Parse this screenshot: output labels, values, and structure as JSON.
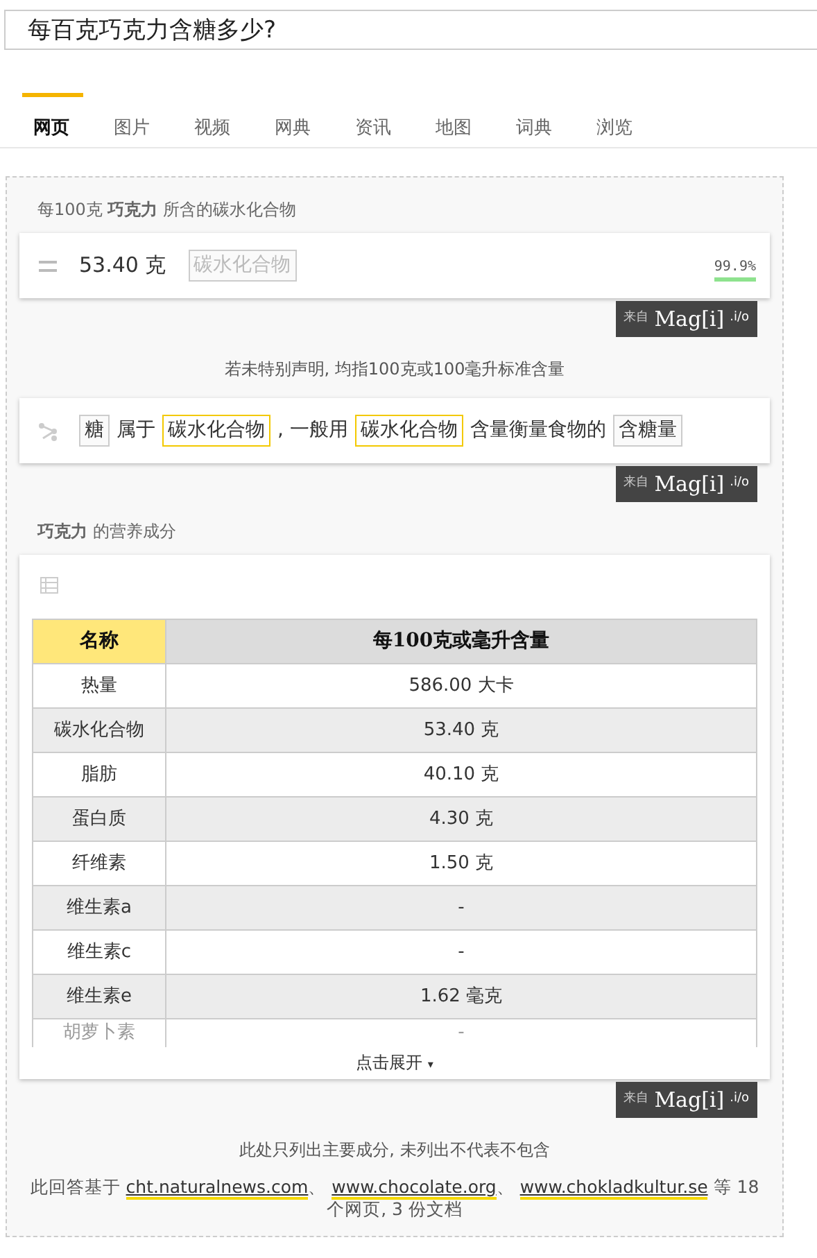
{
  "search": {
    "value": "每百克巧克力含糖多少?"
  },
  "tabs": [
    {
      "label": "网页",
      "selected": true
    },
    {
      "label": "图片",
      "selected": false
    },
    {
      "label": "视频",
      "selected": false
    },
    {
      "label": "网典",
      "selected": false
    },
    {
      "label": "资讯",
      "selected": false
    },
    {
      "label": "地图",
      "selected": false
    },
    {
      "label": "词典",
      "selected": false
    },
    {
      "label": "浏览",
      "selected": false
    }
  ],
  "answer": {
    "title": "每100克 **巧克力** 所含的碳水化合物",
    "value": "53.40 克",
    "tag": "碳水化合物",
    "confidence": "99.9%"
  },
  "source_badges": [
    {
      "prefix": "来自",
      "brand": "Mag[i]",
      "suffix": ".i/o"
    },
    {
      "prefix": "来自",
      "brand": "Mag[i]",
      "suffix": ".i/o"
    },
    {
      "prefix": "来自",
      "brand": "Mag[i]",
      "suffix": ".i/o"
    }
  ],
  "note": "若未特别声明, 均指100克或100毫升标准含量",
  "relation": [
    {
      "kind": "term",
      "text": "糖"
    },
    {
      "kind": "text",
      "text": "属于"
    },
    {
      "kind": "link",
      "text": "碳水化合物"
    },
    {
      "kind": "text",
      "text": ", 一般用"
    },
    {
      "kind": "link",
      "text": "碳水化合物"
    },
    {
      "kind": "text",
      "text": "含量衡量食物的"
    },
    {
      "kind": "term",
      "text": "含糖量"
    }
  ],
  "nutrition": {
    "title": "**巧克力** 的营养成分",
    "columns": [
      "名称",
      "每100克或毫升含量"
    ],
    "rows": [
      [
        "热量",
        "586.00 大卡"
      ],
      [
        "碳水化合物",
        "53.40 克"
      ],
      [
        "脂肪",
        "40.10 克"
      ],
      [
        "蛋白质",
        "4.30 克"
      ],
      [
        "纤维素",
        "1.50 克"
      ],
      [
        "维生素a",
        "-"
      ],
      [
        "维生素c",
        "-"
      ],
      [
        "维生素e",
        "1.62 毫克"
      ],
      [
        "胡萝卜素",
        "-"
      ]
    ],
    "expand": "点击展开",
    "expand_caret": "▾"
  },
  "disclaimer": "此处只列出主要成分, 未列出不代表不包含",
  "sources": {
    "prefix": "此回答基于",
    "links": [
      "cht.naturalnews.com",
      "www.chocolate.org",
      "www.chokladkultur.se"
    ],
    "separator": "、",
    "suffix": "等 18 个网页, 3 份文档"
  }
}
